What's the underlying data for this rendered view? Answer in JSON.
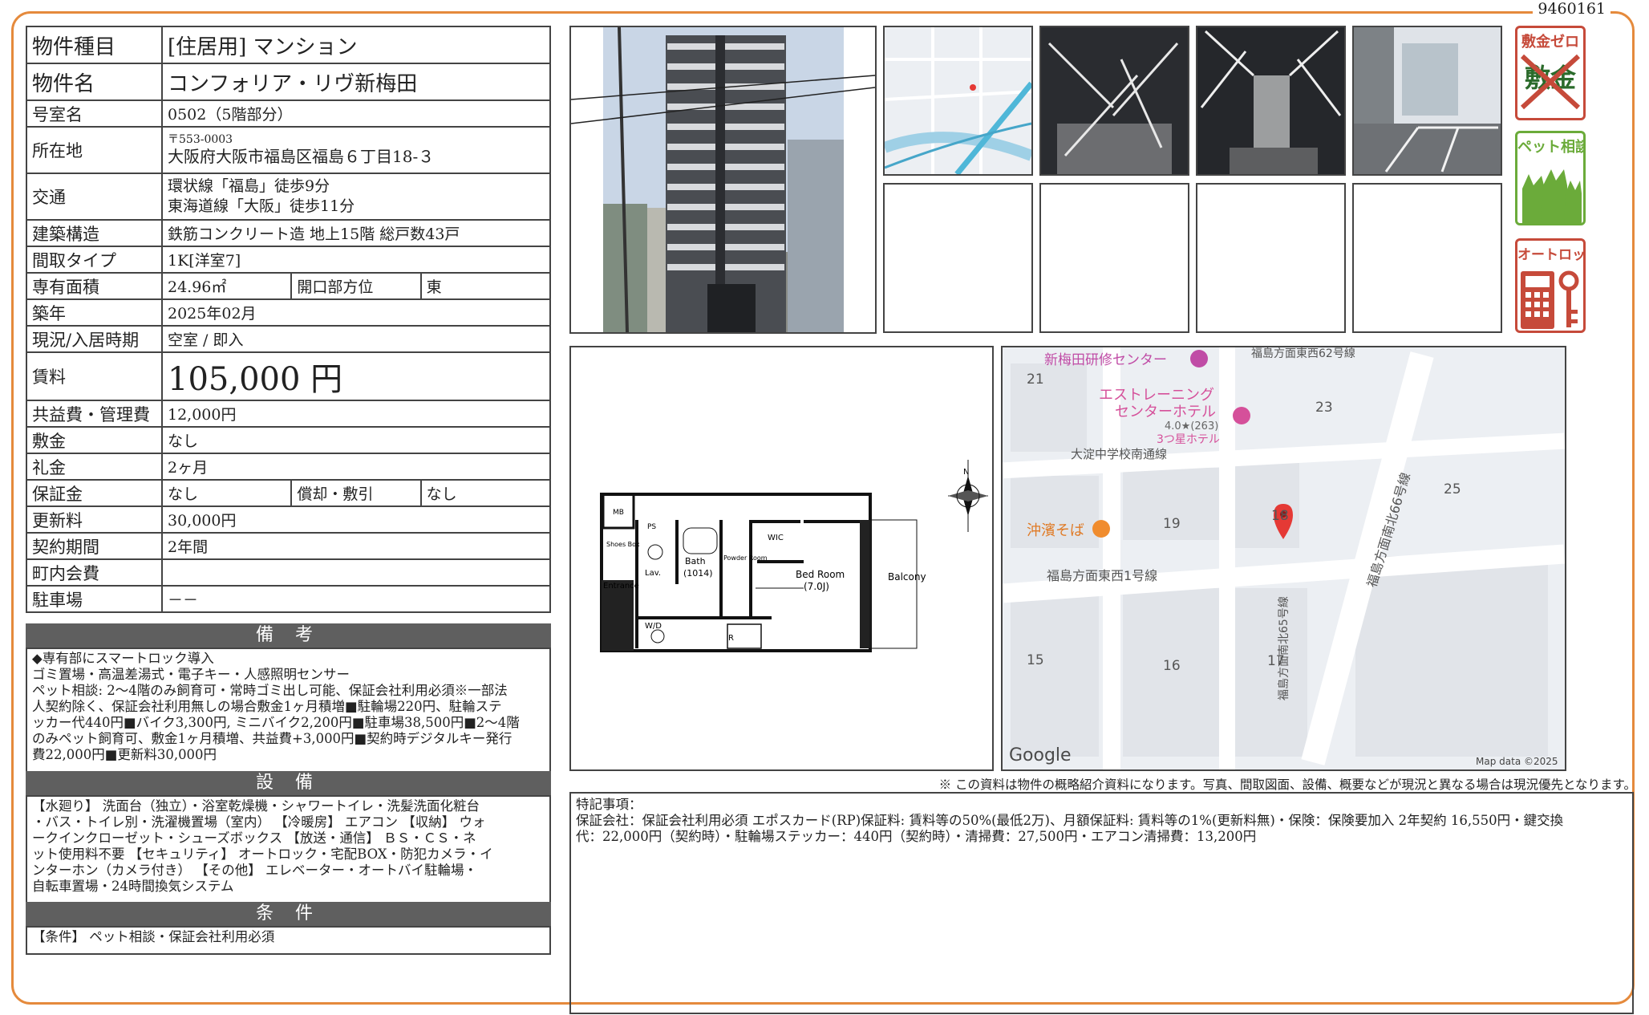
{
  "doc_id": "9460161",
  "spec": {
    "type_label": "物件種目",
    "type_value": "[住居用] マンション",
    "name_label": "物件名",
    "name_value": "コンフォリア・リヴ新梅田",
    "room_label": "号室名",
    "room_value": "0502（5階部分）",
    "addr_label": "所在地",
    "addr_zip": "〒553-0003",
    "addr_value": "大阪府大阪市福島区福島６丁目18-３",
    "access_label": "交通",
    "access_line1": "環状線「福島」徒歩9分",
    "access_line2": "東海道線「大阪」徒歩11分",
    "structure_label": "建築構造",
    "structure_value": "鉄筋コンクリート造 地上15階 総戸数43戸",
    "layout_label": "間取タイプ",
    "layout_value": "1K[洋室7]",
    "area_label": "専有面積",
    "area_value": "24.96㎡",
    "direction_label": "開口部方位",
    "direction_value": "東",
    "built_label": "築年",
    "built_value": "2025年02月",
    "status_label": "現況/入居時期",
    "status_value": "空室 / 即入",
    "rent_label": "賃料",
    "rent_value": "105,000 円",
    "mgmt_label": "共益費・管理費",
    "mgmt_value": "12,000円",
    "deposit_label": "敷金",
    "deposit_value": "なし",
    "keymoney_label": "礼金",
    "keymoney_value": "2ヶ月",
    "guarantee_label": "保証金",
    "guarantee_value": "なし",
    "amort_label": "償却・敷引",
    "amort_value": "なし",
    "renewal_label": "更新料",
    "renewal_value": "30,000円",
    "contract_label": "契約期間",
    "contract_value": "2年間",
    "town_label": "町内会費",
    "town_value": "",
    "parking_label": "駐車場",
    "parking_value": "－－"
  },
  "notes": {
    "title": "備 考",
    "lines": [
      "◆専有部にスマートロック導入",
      "ゴミ置場・高温差湯式・電子キー・人感照明センサー",
      "ペット相談: 2～4階のみ飼育可・常時ゴミ出し可能、保証会社利用必須※一部法",
      "人契約除く、保証会社利用無しの場合敷金1ヶ月積増■駐輪場220円、駐輪ステ",
      "ッカー代440円■バイク3,300円, ミニバイク2,200円■駐車場38,500円■2～4階",
      "のみペット飼育可、敷金1ヶ月積増、共益費+3,000円■契約時デジタルキー発行",
      "費22,000円■更新料30,000円"
    ]
  },
  "equipment": {
    "title": "設 備",
    "lines": [
      "【水廻り】 洗面台（独立）・浴室乾燥機・シャワートイレ・洗髪洗面化粧台",
      "・バス・トイレ別・洗濯機置場（室内） 【冷暖房】 エアコン 【収納】 ウォ",
      "ークインクローゼット・シューズボックス 【放送・通信】 ＢＳ・ＣＳ・ネ",
      "ット使用料不要 【セキュリティ】 オートロック・宅配BOX・防犯カメラ・イ",
      "ンターホン（カメラ付き） 【その他】 エレベーター・オートバイ駐輪場・",
      "自転車置場・24時間換気システム"
    ]
  },
  "conditions": {
    "title": "条 件",
    "text": "【条件】 ペット相談・保証会社利用必須"
  },
  "badges": {
    "zero_title": "敷金ゼロ",
    "zero_strike": "敷金",
    "pet_title": "ペット相談",
    "lock_title": "オートロック"
  },
  "floorplan": {
    "mb": "MB",
    "ps": "PS",
    "shoes": "Shoes Box",
    "lav": "Lav.",
    "bath": "Bath",
    "bath_size": "(1014)",
    "powder": "Powder Room",
    "wic": "WIC",
    "entrance": "Entrance",
    "wd": "W/D",
    "r": "R",
    "bedroom": "Bed Room",
    "bedroom_size": "(7.0J)",
    "balcony": "Balcony",
    "north": "N"
  },
  "map": {
    "training": "新梅田研修センター",
    "road1": "福島方面東西62号線",
    "hotel1": "エストレーニング",
    "hotel2": "センターホテル",
    "rating": "4.0★(263)",
    "hotel_class": "3つ星ホテル",
    "school_road": "大淀中学校南通線",
    "okinawa": "沖濱そば",
    "road2": "福島方面東西1号線",
    "road3": "福島方面南北66号線",
    "road4": "福島方面南北65号線",
    "n21": "21",
    "n23": "23",
    "n25": "25",
    "n19": "19",
    "n18": "18",
    "n15": "15",
    "n16": "16",
    "n17": "17",
    "google": "Google",
    "mapdata": "Map data ©2025"
  },
  "notice": "※ この資料は物件の概略紹介資料になります。写真、間取図面、設備、概要などが現況と異なる場合は現況優先となります。",
  "remarks": {
    "title": "特記事項：",
    "line1": "保証会社：保証会社利用必須 エポスカード(RP)保証料: 賃料等の50%(最低2万)、月額保証料: 賃料等の1%(更新料無)・保険：保険要加入 2年契約 16,550円・鍵交換",
    "line2": "代：22,000円（契約時）・駐輪場ステッカー：440円（契約時）・清掃費：27,500円・エアコン清掃費：13,200円"
  },
  "colors": {
    "frame": "#e58a3c",
    "section_bar": "#5f5f5f",
    "badge_red": "#c64a3a",
    "badge_green": "#6bab3a",
    "map_pin": "#e53935"
  }
}
